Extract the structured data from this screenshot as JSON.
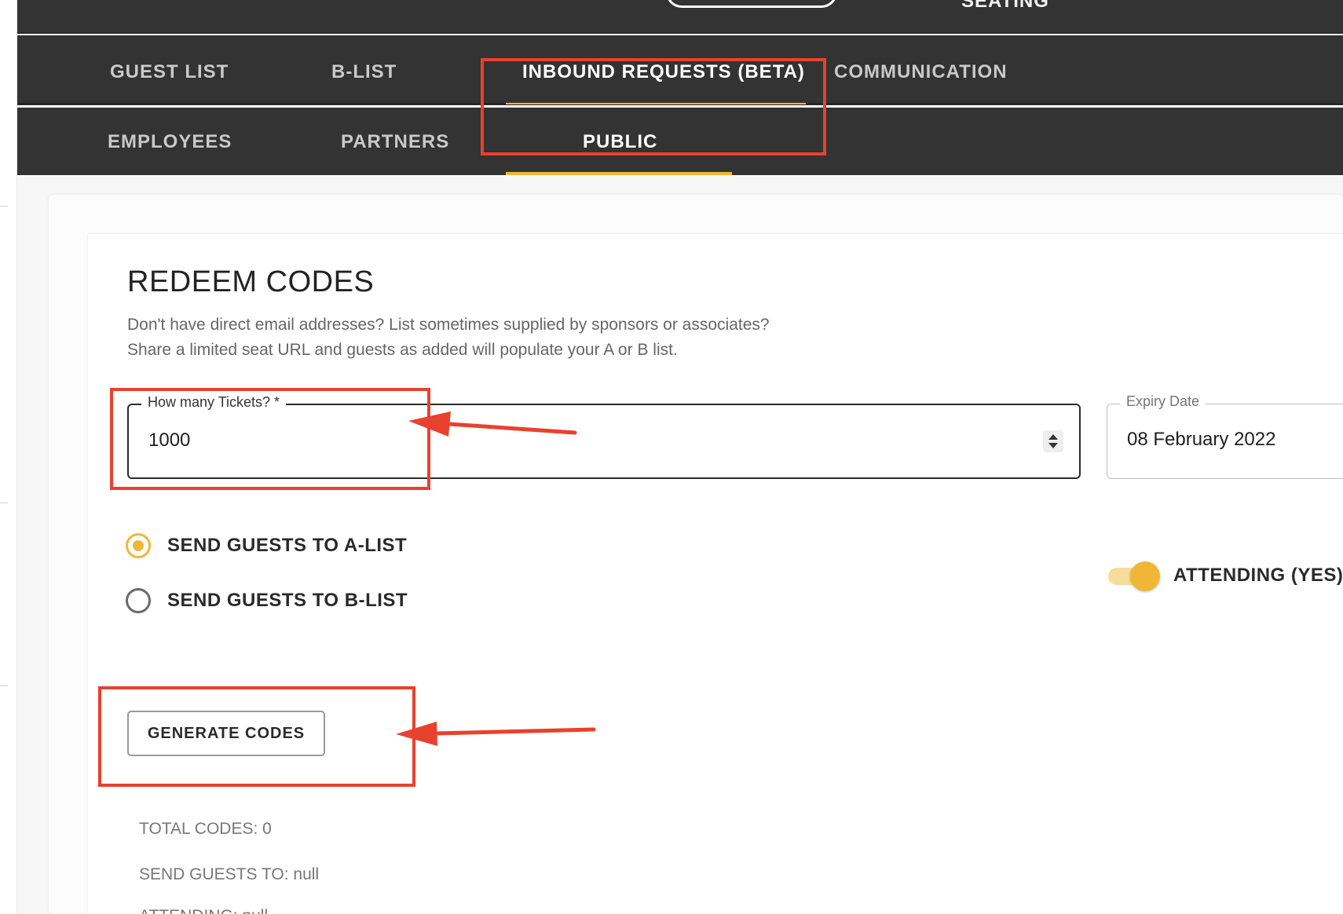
{
  "header": {
    "partial_label": "SEATING"
  },
  "tabs": {
    "row1": [
      {
        "label": "GUEST LIST"
      },
      {
        "label": "B-LIST"
      },
      {
        "label": "INBOUND REQUESTS (BETA)"
      },
      {
        "label": "COMMUNICATION"
      }
    ],
    "row2": [
      {
        "label": "EMPLOYEES"
      },
      {
        "label": "PARTNERS"
      },
      {
        "label": "PUBLIC"
      }
    ]
  },
  "redeem": {
    "title": "REDEEM CODES",
    "description_line1": "Don't have direct email addresses? List sometimes supplied by sponsors or associates?",
    "description_line2": "Share a limited seat URL and guests as added will populate your A or B list.",
    "tickets_label": "How many Tickets? *",
    "tickets_value": "1000",
    "expiry_label": "Expiry Date",
    "expiry_value": "08 February 2022",
    "radio_a_label": "SEND GUESTS TO A-LIST",
    "radio_b_label": "SEND GUESTS TO B-LIST",
    "radio_selected": "a",
    "attending_label": "ATTENDING (YES)",
    "attending_on": true,
    "generate_label": "GENERATE CODES",
    "total_codes": "TOTAL CODES: 0",
    "send_guests_to": "SEND GUESTS TO: null",
    "attending_status": "ATTENDING: null"
  },
  "colors": {
    "accent": "#f0b737",
    "header_bg": "#333333",
    "annotation": "#e8412e"
  }
}
